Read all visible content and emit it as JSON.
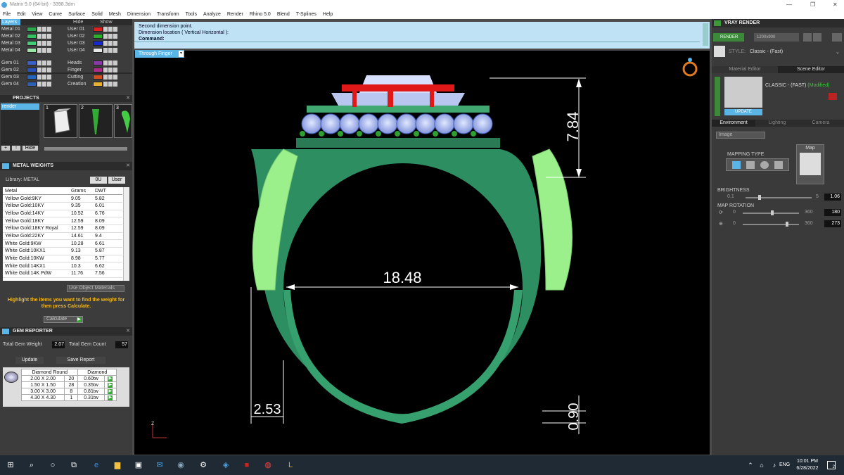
{
  "window": {
    "title": "Matrix 9.0 (64-bit) - 3398.3dm",
    "controls": [
      "—",
      "❐",
      "✕"
    ]
  },
  "menu": [
    "File",
    "Edit",
    "View",
    "Curve",
    "Surface",
    "Solid",
    "Mesh",
    "Dimension",
    "Transform",
    "Tools",
    "Analyze",
    "Render",
    "Rhino 5.0",
    "Blend",
    "T-Splines",
    "Help"
  ],
  "layers": {
    "header_left": "Layers",
    "hide_label": "Hide",
    "show_label": "Show",
    "left": [
      {
        "name": "Metal 01",
        "color": "#2aa84a"
      },
      {
        "name": "Metal 02",
        "color": "#35c060"
      },
      {
        "name": "Metal 03",
        "color": "#44cc77"
      },
      {
        "name": "Metal 04",
        "color": "#9be5a9"
      },
      {
        "name": "Gem 01",
        "color": "#3a62c9"
      },
      {
        "name": "Gem 02",
        "color": "#2a52b9"
      },
      {
        "name": "Gem 03",
        "color": "#2466c0"
      },
      {
        "name": "Gem 04",
        "color": "#2d5fb2"
      }
    ],
    "right": [
      {
        "name": "User 01",
        "color": "#e02020"
      },
      {
        "name": "User 02",
        "color": "#28b028"
      },
      {
        "name": "User 03",
        "color": "#1828d0"
      },
      {
        "name": "User 04",
        "color": "#e8e8e8"
      },
      {
        "name": "Heads",
        "color": "#8a3aa8"
      },
      {
        "name": "Finger",
        "color": "#b02a8a"
      },
      {
        "name": "Cutting",
        "color": "#d05020"
      },
      {
        "name": "Creation",
        "color": "#e8b030"
      }
    ]
  },
  "projects": {
    "header": "PROJECTS",
    "tree_item": "render",
    "thumbs": [
      "1",
      "2",
      "3"
    ],
    "buttons": [
      "+",
      "↑",
      "Hide"
    ]
  },
  "metal_weights": {
    "header": "METAL WEIGHTS",
    "library_label": "Library: METAL",
    "lib_btn1": "0U",
    "lib_btn2": "User",
    "columns": [
      "Metal",
      "Grams",
      "DWT"
    ],
    "rows": [
      [
        "Yellow Gold:9KY",
        "9.05",
        "5.82"
      ],
      [
        "Yellow Gold:10KY",
        "9.35",
        "6.01"
      ],
      [
        "Yellow Gold:14KY",
        "10.52",
        "6.76"
      ],
      [
        "Yellow Gold:18KY",
        "12.59",
        "8.09"
      ],
      [
        "Yellow Gold:18KY Royal",
        "12.59",
        "8.09"
      ],
      [
        "Yellow Gold:22KY",
        "14.61",
        "9.4"
      ],
      [
        "White Gold:9KW",
        "10.28",
        "6.61"
      ],
      [
        "White Gold:10KX1",
        "9.13",
        "5.87"
      ],
      [
        "White Gold:10KW",
        "8.98",
        "5.77"
      ],
      [
        "White Gold:14KX1",
        "10.3",
        "6.62"
      ],
      [
        "White Gold:14K PdW",
        "11.76",
        "7.56"
      ]
    ],
    "use_object": "Use Object Materials",
    "hint": "Highlight the items you want to find the weight for then press Calculate.",
    "calculate": "Calculate"
  },
  "gem_reporter": {
    "header": "GEM REPORTER",
    "total_weight_label": "Total Gem Weight",
    "total_weight": "2.07",
    "total_count_label": "Total Gem Count",
    "total_count": "57",
    "update": "Update",
    "save_report": "Save Report",
    "columns": [
      "Diamond Round",
      "Diamond"
    ],
    "rows": [
      [
        "2.00 X 2.00",
        "20",
        "0.60tw"
      ],
      [
        "1.50 X 1.50",
        "28",
        "0.35tw"
      ],
      [
        "3.00 X 3.00",
        "8",
        "0.81tw"
      ],
      [
        "4.30 X 4.30",
        "1",
        "0.31tw"
      ]
    ]
  },
  "command": {
    "line1": "Second dimension point.",
    "line2": "Dimension location ( Vertical  Horizontal ):",
    "prompt": "Command:"
  },
  "viewport": {
    "label": "Through Finger",
    "dims": {
      "top_height": "7.84",
      "inner_diameter": "18.48",
      "shank_width": "2.53",
      "bottom_thickness": "0.90"
    },
    "axis_label": "Z"
  },
  "vray": {
    "header": "VRAY RENDER",
    "render_btn": "RENDER",
    "resolution": "1200x900",
    "style_label": "STYLE:",
    "style_value": "Classic - (Fast)",
    "tab_material": "Material Editor",
    "tab_scene": "Scene Editor",
    "preset_name": "CLASSIC - (FAST)",
    "preset_modified": "(Modified)",
    "update_btn": "UPDATE",
    "subtabs": [
      "Environment",
      "Lighting",
      "Camera"
    ],
    "env_dropdown": "Image",
    "mapping_type": "MAPPING TYPE",
    "map_label": "Map",
    "brightness_label": "BRIGHTNESS",
    "brightness_min": "0.1",
    "brightness_max": "5",
    "brightness_value": "1.06",
    "map_rotation_label": "MAP ROTATION",
    "rot1_min": "0",
    "rot1_max": "360",
    "rot1_value": "180",
    "rot2_min": "0",
    "rot2_max": "360",
    "rot2_value": "273"
  },
  "taskbar": {
    "lang": "ENG",
    "time": "10:01 PM",
    "date": "6/28/2022",
    "notif_count": "2"
  },
  "colors": {
    "ring_green": "#2f9a6a",
    "ring_light": "#8ee88a",
    "accent_blue": "#5ab4e6",
    "dim_white": "#ffffff"
  }
}
